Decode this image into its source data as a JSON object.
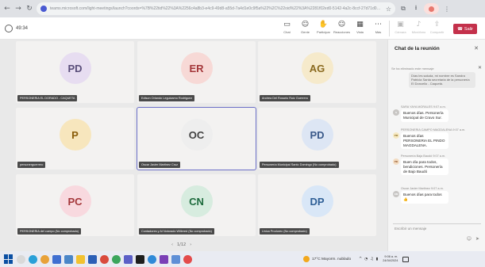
{
  "browser": {
    "url": "teams.microsoft.com/light-meetings/launch?coords=%7B%22tid%22%3A%2256c4a8b3-e4c9-49d8-a55d-7a4d1e0c9f5a%22%2C%22oid%22%3A%2281f02ed0-5142-4a2c-8ccf-27d71d0d9f4f%22%7D&anon=true&deeplink"
  },
  "toolbar": {
    "timer": "49:34",
    "tools": [
      {
        "label": "Chat",
        "icon": "chat-icon"
      },
      {
        "label": "Gente",
        "icon": "people-icon"
      },
      {
        "label": "Participar",
        "icon": "raise-hand-icon"
      },
      {
        "label": "Reacciones",
        "icon": "reactions-icon"
      },
      {
        "label": "Vista",
        "icon": "view-icon"
      },
      {
        "label": "Más",
        "icon": "more-icon"
      },
      {
        "label": "Cámara",
        "icon": "camera-icon"
      },
      {
        "label": "Micrófono",
        "icon": "microphone-icon"
      },
      {
        "label": "Compartir",
        "icon": "share-icon"
      }
    ],
    "leave_label": "Salir"
  },
  "participants": [
    {
      "initials": "PD",
      "name": "PERSONERIA EL DORADO - CAQUETA",
      "avatar_bg": "#e7ddf1",
      "avatar_fg": "#5a4e7a"
    },
    {
      "initials": "ER",
      "name": "Edison Orlando Leguizamo Rodriguez",
      "avatar_bg": "#f7d9d6",
      "avatar_fg": "#a4373a"
    },
    {
      "initials": "AG",
      "name": "Andrea Del Rosario Ruiz Guerrero",
      "avatar_bg": "#f6eacb",
      "avatar_fg": "#8a6a1f"
    },
    {
      "initials": "P",
      "name": "personerguerrero",
      "avatar_bg": "#f7e6bd",
      "avatar_fg": "#8a5d0a"
    },
    {
      "initials": "OC",
      "name": "Oscar Javier Martinez Cruz",
      "avatar_bg": "#eeeeee",
      "avatar_fg": "#424242"
    },
    {
      "initials": "PD",
      "name": "Personería Municipal Santo Domingo (No comprobado)",
      "avatar_bg": "#dde6f4",
      "avatar_fg": "#3b5a8a"
    },
    {
      "initials": "PC",
      "name": "PERSONERIA del cuerpo (No comprobado)",
      "avatar_bg": "#f8d9df",
      "avatar_fg": "#a4373a"
    },
    {
      "initials": "CN",
      "name": "Contadores y Al Notorado Willered (No comprobado)",
      "avatar_bg": "#d7ecdf",
      "avatar_fg": "#1e6b3d"
    },
    {
      "initials": "DP",
      "name": "Unica Produrec (No comprobado)",
      "avatar_bg": "#d9e7f7",
      "avatar_fg": "#2f5f96"
    }
  ],
  "pager": {
    "text": "1/12",
    "prev": "‹",
    "next": "›"
  },
  "chat": {
    "title": "Chat de la reunión",
    "note_head": "Se ha eliminado este mensaje",
    "note_text": "Días les saluda, mi nombre es Sandra Patricia Santa secretaria de la personería El Doncello - Caquetá.",
    "messages": [
      {
        "meta": "SARA YAYA MORALES   9:07 a.m.",
        "text": "Buenos días. Personería Municipal de Cravo Sur.",
        "initials": "S",
        "av_bg": "#c8c6c4",
        "av_fg": "#ffffff"
      },
      {
        "meta": "PERSONERIA CAMPO MAGDALENA   9:07 a.m.",
        "text": "Buenos días PERSONERIA EL PINDO MAGDALENA.",
        "initials": "PM",
        "av_bg": "#f6e9c3",
        "av_fg": "#8a6a1f"
      },
      {
        "meta": "Personería Baja Baudó   9:07 a.m.",
        "text": "Buen día para todos, bendiciones. Personería de Bajo Baudó",
        "initials": "PB",
        "av_bg": "#f3dcc2",
        "av_fg": "#8a4b1f"
      },
      {
        "meta": "Oscar Javier Martinez   9:07 a.m.",
        "text": "Buenos días para todos 👍",
        "initials": "OM",
        "av_bg": "#c8c6c4",
        "av_fg": "#ffffff"
      }
    ],
    "compose_placeholder": "Escribir un mensaje"
  },
  "taskbar": {
    "weather": "17°C  Mayorm. nublado",
    "time": "9:06 a. m.",
    "date": "24/04/2024"
  }
}
